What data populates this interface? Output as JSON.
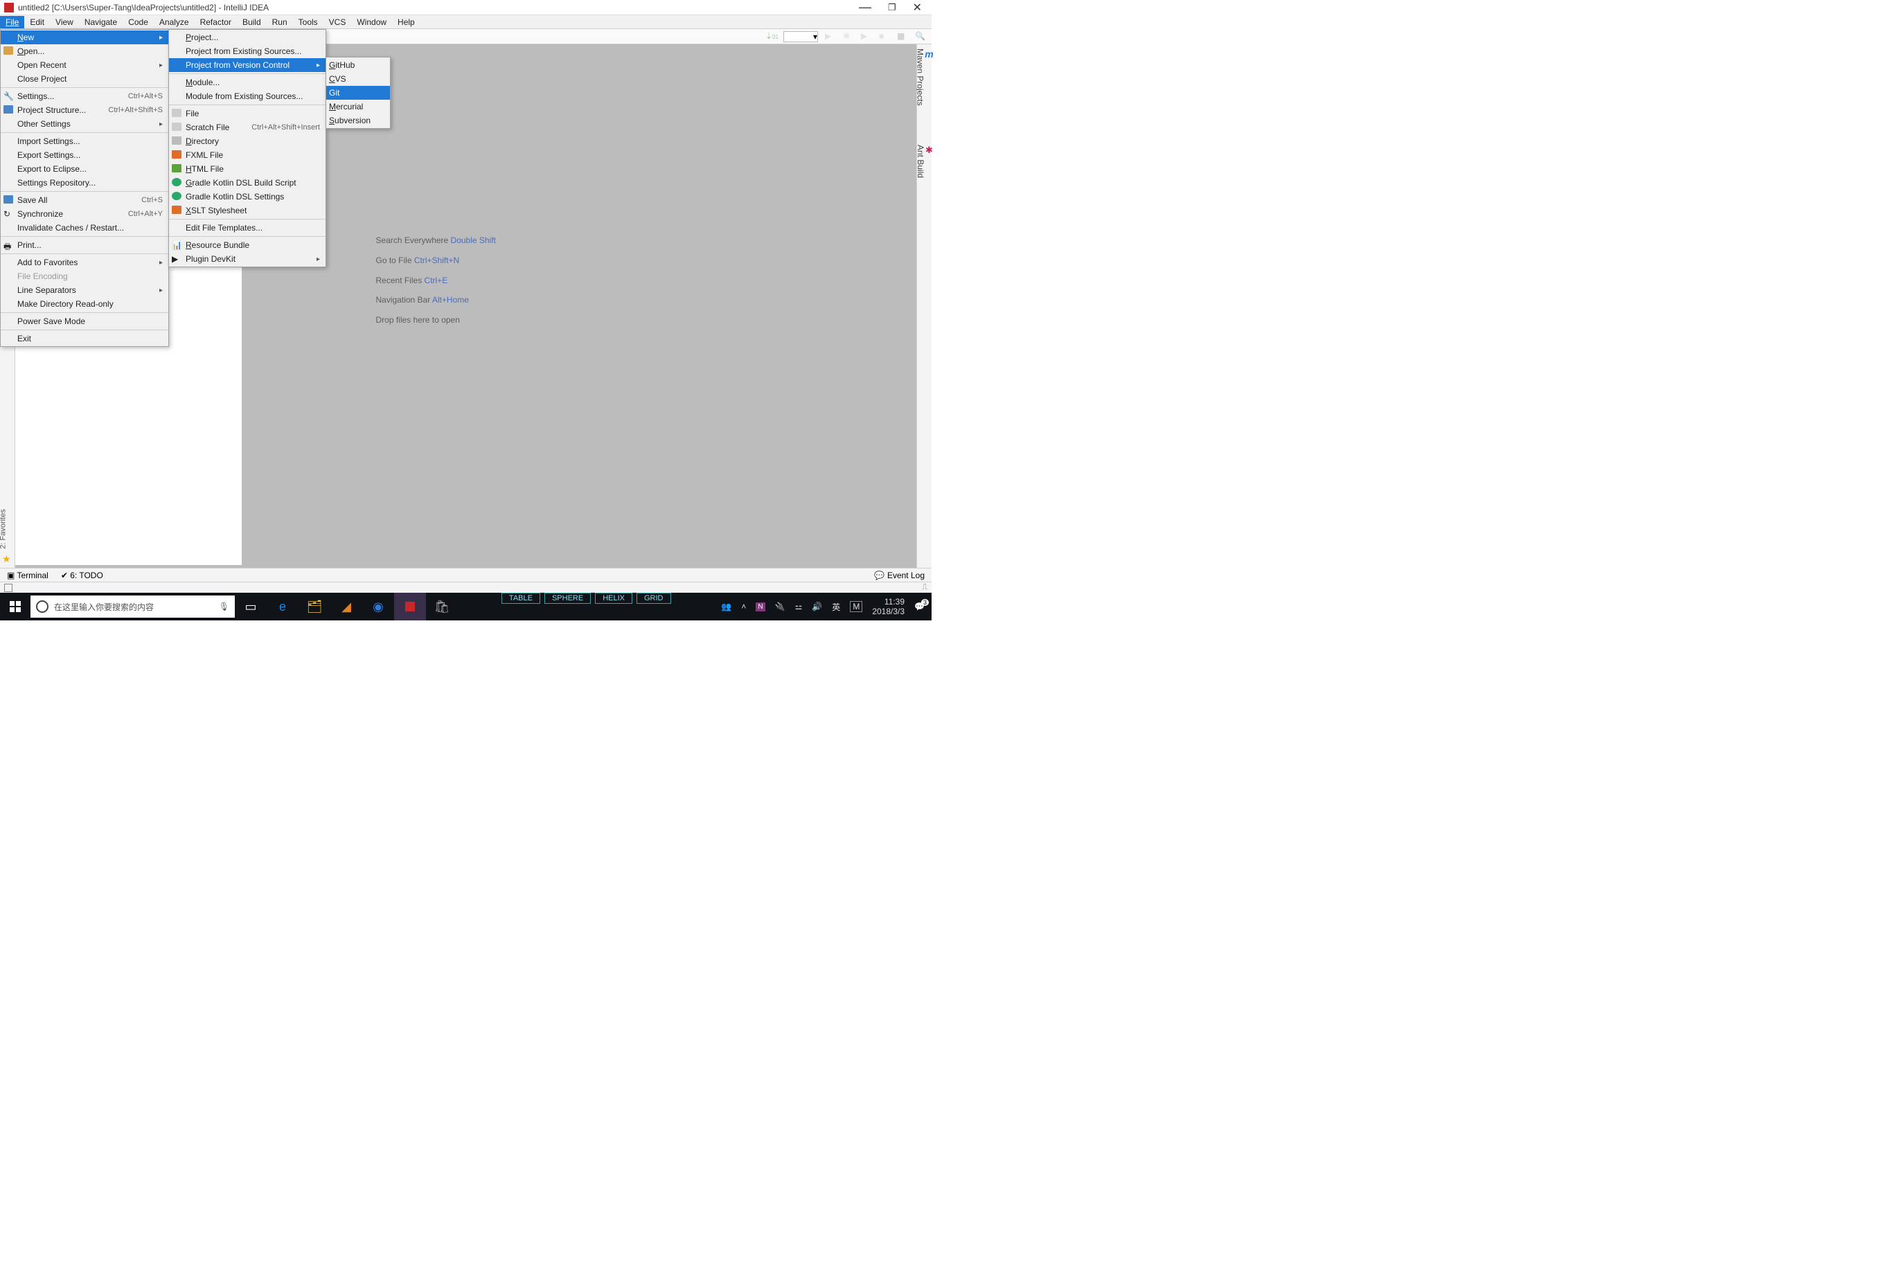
{
  "titlebar": {
    "text": "untitled2 [C:\\Users\\Super-Tang\\IdeaProjects\\untitled2] - IntelliJ IDEA"
  },
  "menubar": {
    "items": [
      "File",
      "Edit",
      "View",
      "Navigate",
      "Code",
      "Analyze",
      "Refactor",
      "Build",
      "Run",
      "Tools",
      "VCS",
      "Window",
      "Help"
    ],
    "open_index": 0
  },
  "file_menu": {
    "new": "New",
    "open": "Open...",
    "open_recent": "Open Recent",
    "close_project": "Close Project",
    "settings": "Settings...",
    "settings_short": "Ctrl+Alt+S",
    "project_structure": "Project Structure...",
    "project_structure_short": "Ctrl+Alt+Shift+S",
    "other_settings": "Other Settings",
    "import_settings": "Import Settings...",
    "export_settings": "Export Settings...",
    "export_eclipse": "Export to Eclipse...",
    "settings_repo": "Settings Repository...",
    "save_all": "Save All",
    "save_all_short": "Ctrl+S",
    "synchronize": "Synchronize",
    "synchronize_short": "Ctrl+Alt+Y",
    "invalidate": "Invalidate Caches / Restart...",
    "print": "Print...",
    "add_fav": "Add to Favorites",
    "file_encoding": "File Encoding",
    "line_sep": "Line Separators",
    "make_readonly": "Make Directory Read-only",
    "power_save": "Power Save Mode",
    "exit": "Exit"
  },
  "new_submenu": {
    "project": "Project...",
    "project_existing": "Project from Existing Sources...",
    "project_vcs": "Project from Version Control",
    "module": "Module...",
    "module_existing": "Module from Existing Sources...",
    "file": "File",
    "scratch": "Scratch File",
    "scratch_short": "Ctrl+Alt+Shift+Insert",
    "directory": "Directory",
    "fxml": "FXML File",
    "html": "HTML File",
    "gradle_build": "Gradle Kotlin DSL Build Script",
    "gradle_settings": "Gradle Kotlin DSL Settings",
    "xslt": "XSLT Stylesheet",
    "edit_tpl": "Edit File Templates...",
    "resource": "Resource Bundle",
    "plugin_devkit": "Plugin DevKit"
  },
  "vcs_submenu": {
    "github": "GitHub",
    "cvs": "CVS",
    "git": "Git",
    "mercurial": "Mercurial",
    "subversion": "Subversion"
  },
  "editor_hints": {
    "search": "Search Everywhere ",
    "search_kb": "Double Shift",
    "goto": "Go to File ",
    "goto_kb": "Ctrl+Shift+N",
    "recent": "Recent Files ",
    "recent_kb": "Ctrl+E",
    "nav": "Navigation Bar ",
    "nav_kb": "Alt+Home",
    "drop": "Drop files here to open"
  },
  "tool_windows": {
    "terminal": "Terminal",
    "todo": "6: TODO",
    "event_log": "Event Log",
    "favorites": "2: Favorites",
    "maven": "Maven Projects",
    "ant": "Ant Build"
  },
  "taskbar": {
    "search_placeholder": "在这里输入你要搜索的内容",
    "tabs": [
      "TABLE",
      "SPHERE",
      "HELIX",
      "GRID"
    ],
    "ime1": "英",
    "ime2": "M",
    "time": "11:39",
    "date": "2018/3/3",
    "notif_count": "3"
  }
}
